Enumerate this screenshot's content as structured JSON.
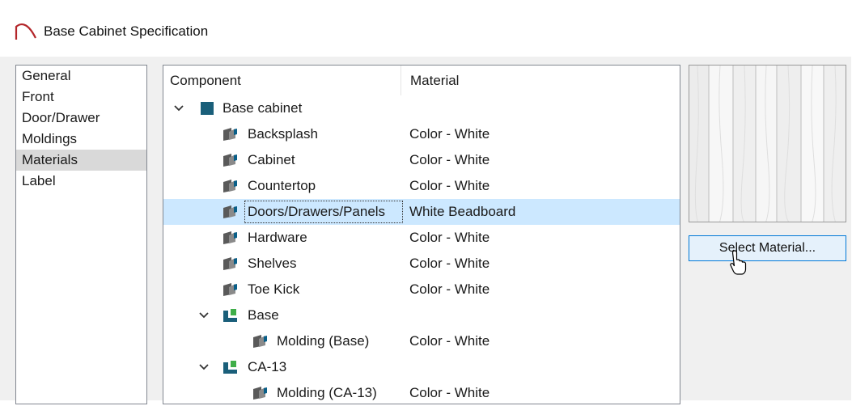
{
  "window": {
    "title": "Base Cabinet Specification"
  },
  "nav": {
    "items": [
      {
        "label": "General"
      },
      {
        "label": "Front"
      },
      {
        "label": "Door/Drawer"
      },
      {
        "label": "Moldings"
      },
      {
        "label": "Materials",
        "selected": true
      },
      {
        "label": "Label"
      }
    ]
  },
  "tree": {
    "headers": {
      "component": "Component",
      "material": "Material"
    },
    "rows": [
      {
        "name": "Base cabinet",
        "material": "",
        "icon": "cabinet-square-icon",
        "expander": "chevron-down-icon"
      },
      {
        "name": "Backsplash",
        "material": "Color - White",
        "icon": "material-swatch-icon"
      },
      {
        "name": "Cabinet",
        "material": "Color - White",
        "icon": "material-swatch-icon"
      },
      {
        "name": "Countertop",
        "material": "Color - White",
        "icon": "material-swatch-icon"
      },
      {
        "name": "Doors/Drawers/Panels",
        "material": "White Beadboard",
        "icon": "material-swatch-icon",
        "selected": true
      },
      {
        "name": "Hardware",
        "material": "Color - White",
        "icon": "material-swatch-icon"
      },
      {
        "name": "Shelves",
        "material": "Color - White",
        "icon": "material-swatch-icon"
      },
      {
        "name": "Toe Kick",
        "material": "Color - White",
        "icon": "material-swatch-icon"
      },
      {
        "name": "Base",
        "material": "",
        "icon": "molding-profile-icon",
        "expander": "chevron-down-icon"
      },
      {
        "name": "Molding (Base)",
        "material": "Color - White",
        "icon": "material-swatch-icon"
      },
      {
        "name": "CA-13",
        "material": "",
        "icon": "molding-profile-icon",
        "expander": "chevron-down-icon"
      },
      {
        "name": "Molding (CA-13)",
        "material": "Color - White",
        "icon": "material-swatch-icon"
      }
    ]
  },
  "preview": {
    "material": "White Beadboard",
    "icon": "beadboard-texture"
  },
  "actions": {
    "select_material_label": "Select Material..."
  },
  "colors": {
    "selection": "#cce8ff",
    "nav_selection": "#d9d9d9",
    "button_accent": "#0078d7",
    "icon_teal": "#1a5f7a",
    "icon_green": "#3fae49"
  }
}
